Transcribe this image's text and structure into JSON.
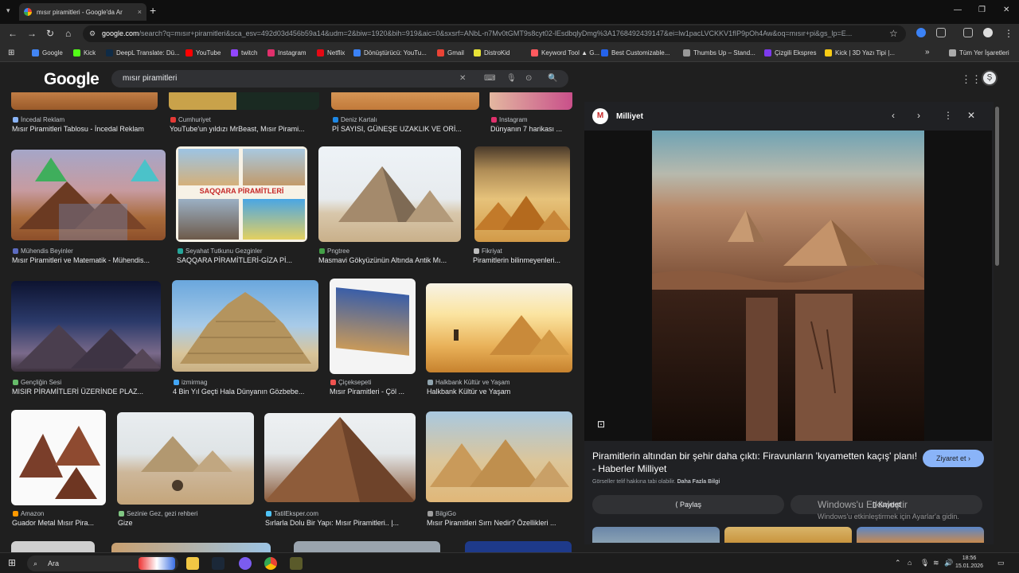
{
  "browser": {
    "tab_title": "mısır piramitleri - Google'da Ar",
    "tab_close": "×",
    "new_tab": "+",
    "url_host": "google.com",
    "url_rest": "/search?q=mısır+piramitleri&sca_esv=492d03d456b59a14&udm=2&biw=1920&bih=919&aic=0&sxsrf=ANbL-n7Mv0tGMT9s8cyt02-lEsdbqlyDmg%3A1768492439147&ei=lw1pacLVCKKV1fIP9pOh4Aw&oq=mısır+pi&gs_lp=E...",
    "bookmarks": [
      {
        "label": "Google",
        "color": "#4285f4"
      },
      {
        "label": "Kick",
        "color": "#53fc18"
      },
      {
        "label": "DeepL Translate: Dü...",
        "color": "#0f2b46"
      },
      {
        "label": "YouTube",
        "color": "#ff0000"
      },
      {
        "label": "twitch",
        "color": "#9146ff"
      },
      {
        "label": "Instagram",
        "color": "#e1306c"
      },
      {
        "label": "Netflix",
        "color": "#e50914"
      },
      {
        "label": "Dönüştürücü: YouTu...",
        "color": "#3b82f6"
      },
      {
        "label": "Gmail",
        "color": "#ea4335"
      },
      {
        "label": "DistroKid",
        "color": "#e8e337"
      },
      {
        "label": "Keyword Tool ▲ G...",
        "color": "#ff5a5f"
      },
      {
        "label": "Best Customizable...",
        "color": "#2563eb"
      },
      {
        "label": "Thumbs Up – Stand...",
        "color": "#999999"
      },
      {
        "label": "Çizgili Ekspres",
        "color": "#7c3aed"
      },
      {
        "label": "Kick | 3D Yazı Tipi |...",
        "color": "#facc15"
      }
    ],
    "bookmarks_more": "»",
    "all_bookmarks": "Tüm Yer İşaretleri"
  },
  "google": {
    "logo": "Google",
    "query": "mısır piramitleri",
    "avatar_letter": "Ş"
  },
  "results": [
    {
      "source": "İncedal Reklam",
      "caption": "Mısır Piramitleri Tablosu - İncedal Reklam",
      "src_color": "#8ab4f8"
    },
    {
      "source": "Cumhuriyet",
      "caption": "YouTube'un yıldızı MrBeast, Mısır Pirami...",
      "src_color": "#e53935"
    },
    {
      "source": "Deniz Kartalı",
      "caption": "Pİ SAYISI, GÜNEŞE UZAKLIK VE ORİ...",
      "src_color": "#1e88e5"
    },
    {
      "source": "Instagram",
      "caption": "Dünyanın 7 harikası ...",
      "src_color": "#e1306c"
    },
    {
      "source": "Mühendis Beyinler",
      "caption": "Mısır Piramitleri ve Matematik - Mühendis...",
      "src_color": "#5c6bc0"
    },
    {
      "source": "Seyahat Tutkunu Gezginler",
      "caption": "SAQQARA PİRAMİTLERİ-GİZA Pİ...",
      "src_color": "#26a69a",
      "image_text": "SAQQARA PİRAMİTLERİ"
    },
    {
      "source": "Pngtree",
      "caption": "Masmavi Gökyüzünün Altında Antik Mı...",
      "src_color": "#43a047"
    },
    {
      "source": "Fikriyat",
      "caption": "Piramitlerin bilinmeyenleri...",
      "src_color": "#bdbdbd"
    },
    {
      "source": "Gençliğin Sesi",
      "caption": "MISIR PİRAMİTLERİ ÜZERİNDE PLAZ...",
      "src_color": "#66bb6a"
    },
    {
      "source": "izmirmag",
      "caption": "4 Bin Yıl Geçti Hala Dünyanın Gözbebe...",
      "src_color": "#42a5f5"
    },
    {
      "source": "Çiçeksepeti",
      "caption": "Mısır Piramitleri - Çöl ...",
      "src_color": "#ef5350"
    },
    {
      "source": "Halkbank Kültür ve Yaşam",
      "caption": "Halkbank Kültür ve Yaşam",
      "src_color": "#90a4ae"
    },
    {
      "source": "Amazon",
      "caption": "Guador Metal Mısır Pira...",
      "src_color": "#ff9900"
    },
    {
      "source": "Sezinie Gez, gezi rehberi",
      "caption": "Gize",
      "src_color": "#81c784"
    },
    {
      "source": "TatilEksper.com",
      "caption": "Sırlarla Dolu Bir Yapı: Mısır Piramitleri.. |...",
      "src_color": "#4fc3f7"
    },
    {
      "source": "BilgiGo",
      "caption": "Mısır Piramitleri Sırrı Nedir? Özellikleri ...",
      "src_color": "#9e9e9e"
    }
  ],
  "panel": {
    "site": "Milliyet",
    "logo_letter": "M",
    "title": "Piramitlerin altından bir şehir daha çıktı: Firavunların 'kıyametten kaçış' planı! - Haberler Milliyet",
    "visit_label": "Ziyaret et",
    "copyright_note": "Görseller telif hakkına tabi olabilir.",
    "more_info": "Daha Fazla Bilgi",
    "share_label": "Paylaş",
    "save_label": "Kaydet"
  },
  "watermark": {
    "line1": "Windows'u Etkinleştir",
    "line2": "Windows'u etkinleştirmek için Ayarlar'a gidin."
  },
  "taskbar": {
    "search_label": "Ara",
    "time": "18:56",
    "date": "15.01.2026"
  }
}
